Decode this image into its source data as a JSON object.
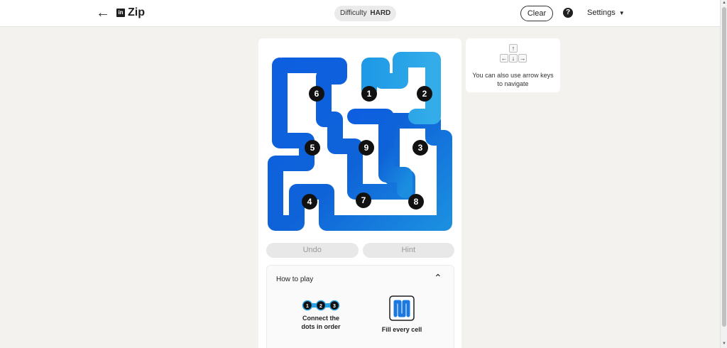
{
  "header": {
    "back_icon": "arrow-left",
    "logo_text": "in",
    "app_name": "Zip",
    "difficulty_label": "Difficulty",
    "difficulty_value": "HARD",
    "clear_label": "Clear",
    "help_icon": "question-circle",
    "settings_label": "Settings"
  },
  "board": {
    "size": 6,
    "path_color_light": "#29a3e6",
    "path_color_dark": "#0a4fd6",
    "dots": [
      {
        "number": "1",
        "row": 0,
        "col": 2
      },
      {
        "number": "2",
        "row": 0,
        "col": 3
      },
      {
        "number": "3",
        "row": 1,
        "col": 3
      },
      {
        "number": "4",
        "row": 3,
        "col": 0
      },
      {
        "number": "5",
        "row": 1,
        "col": 0
      },
      {
        "number": "6",
        "row": 0,
        "col": 0
      },
      {
        "number": "7",
        "row": 3,
        "col": 1
      },
      {
        "number": "8",
        "row": 3,
        "col": 2
      },
      {
        "number": "9",
        "row": 1,
        "col": 1
      }
    ]
  },
  "controls": {
    "undo_label": "Undo",
    "hint_label": "Hint"
  },
  "how_to_play": {
    "title": "How to play",
    "rule1_dots": [
      "1",
      "2",
      "3"
    ],
    "rule1_text": "Connect the dots in order",
    "rule2_text": "Fill every cell"
  },
  "tip": {
    "text": "You can also use arrow keys to navigate"
  }
}
